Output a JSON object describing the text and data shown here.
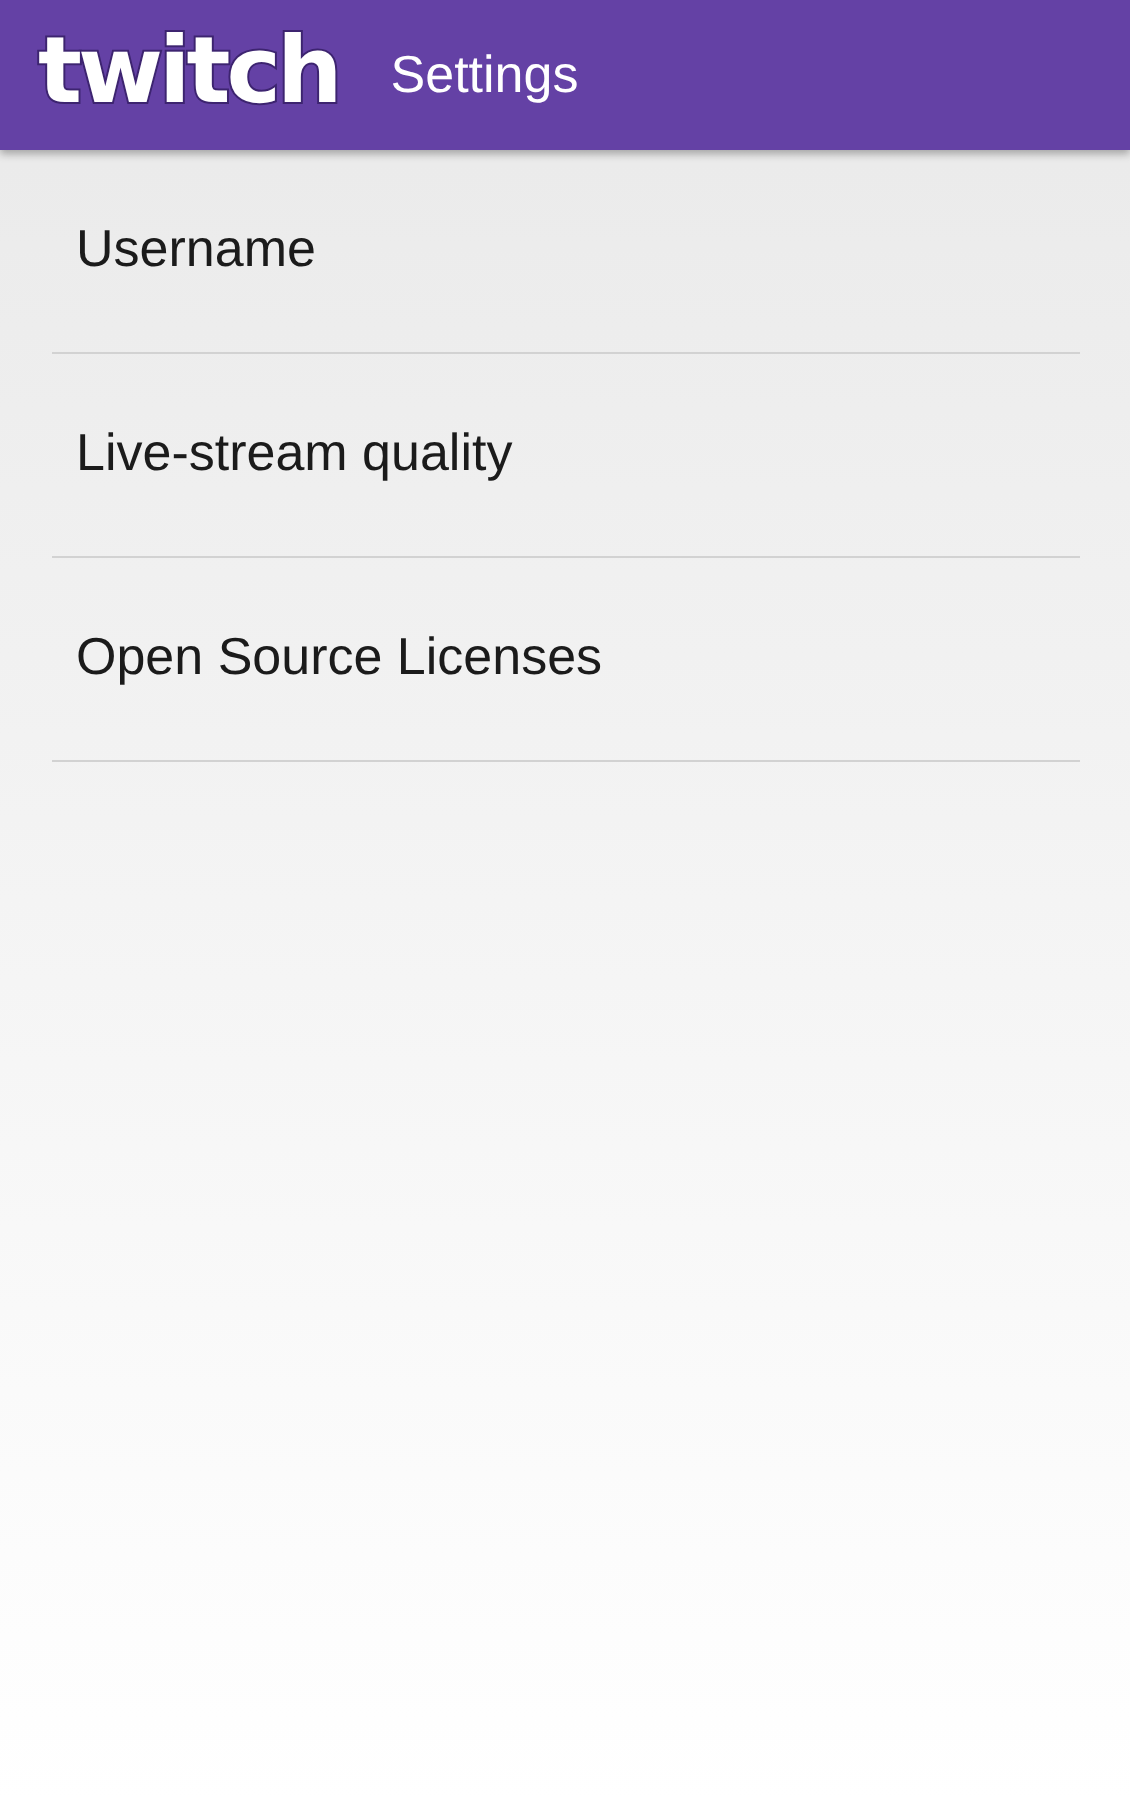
{
  "app_bar": {
    "logo": "twitch",
    "title": "Settings"
  },
  "settings": [
    {
      "label": "Username"
    },
    {
      "label": "Live-stream quality"
    },
    {
      "label": "Open Source Licenses"
    }
  ]
}
